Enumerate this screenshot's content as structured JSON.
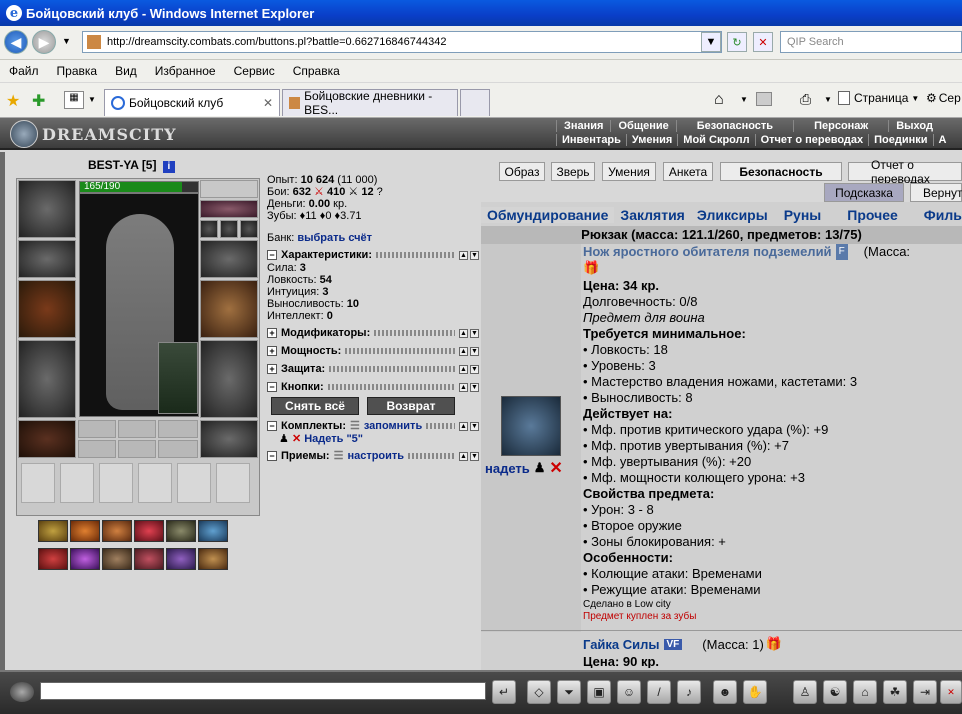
{
  "window": {
    "title": "Бойцовский клуб - Windows Internet Explorer"
  },
  "address": {
    "url": "http://dreamscity.combats.com/buttons.pl?battle=0.662716846744342",
    "search_placeholder": "QIP Search"
  },
  "menu": [
    "Файл",
    "Правка",
    "Вид",
    "Избранное",
    "Сервис",
    "Справка"
  ],
  "tabs": [
    {
      "label": "Бойцовский клуб"
    },
    {
      "label": "Бойцовские дневники - BES..."
    }
  ],
  "commands": {
    "page": "Страница",
    "service": "Сер"
  },
  "game": {
    "logo": "DREAMSCITY",
    "nav_top": [
      "Знания",
      "Общение",
      "Безопасность",
      "Персонаж",
      "Выход"
    ],
    "nav_sub": [
      "Инвентарь",
      "Умения",
      "Мой Скролл",
      "Отчет о переводах",
      "Поединки",
      "А"
    ]
  },
  "character": {
    "name": "BEST-YA",
    "level": "[5]",
    "info_icon": "i",
    "hp": "165/190",
    "hp_fraction": 0.868
  },
  "stats": {
    "exp_label": "Опыт:",
    "exp_value": "10 624",
    "exp_next": "(11 000)",
    "battles_label": "Бои:",
    "wins": "632",
    "losses": "410",
    "draws": "12",
    "money_label": "Деньги:",
    "money_value": "0.00",
    "money_unit": "кр.",
    "teeth_label": "Зубы:",
    "teeth_1": "11",
    "teeth_2": "0",
    "teeth_3": "3.71",
    "bank_label": "Банк:",
    "bank_link": "выбрать счёт",
    "chars_header": "Характеристики:",
    "attrs": [
      {
        "label": "Сила:",
        "value": "3"
      },
      {
        "label": "Ловкость:",
        "value": "54"
      },
      {
        "label": "Интуиция:",
        "value": "3"
      },
      {
        "label": "Выносливость:",
        "value": "10"
      },
      {
        "label": "Интеллект:",
        "value": "0"
      }
    ],
    "modifiers": "Модификаторы:",
    "powers": "Мощность:",
    "defense": "Защита:",
    "buttons": "Кнопки:",
    "btn_undress": "Снять всё",
    "btn_return": "Возврат",
    "sets": "Комплекты:",
    "sets_link": "запомнить",
    "wear_set": "Надеть \"5\"",
    "tricks": "Приемы:",
    "tricks_link": "настроить"
  },
  "top_buttons": [
    "Образ",
    "Зверь",
    "Умения",
    "Анкета",
    "Безопасность",
    "Отчет о переводах"
  ],
  "hint_buttons": {
    "hint": "Подсказка",
    "back": "Вернуть"
  },
  "inventory": {
    "tabs": [
      "Обмундирование",
      "Заклятия",
      "Эликсиры",
      "Руны",
      "Прочее",
      "Филь"
    ],
    "backpack": "Рюкзак (масса: 121.1/260, предметов: 13/75)",
    "wear_link": "надеть",
    "item": {
      "name": "Нож яростного обитателя подземелий",
      "badge": "F",
      "mass": "(Масса:",
      "price": "Цена: 34 кр.",
      "durability": "Долговечность: 0/8",
      "class_note": "Предмет для воина",
      "req_header": "Требуется минимальное:",
      "reqs": [
        "• Ловкость: 18",
        "• Уровень: 3",
        "• Мастерство владения ножами, кастетами: 3",
        "• Выносливость: 8"
      ],
      "acts_header": "Действует на:",
      "acts": [
        "• Мф. против критического удара (%): +9",
        "• Мф. против увертывания (%): +7",
        "• Мф. увертывания (%): +20",
        "• Мф. мощности колющего урона: +3"
      ],
      "props_header": "Свойства предмета:",
      "props": [
        "• Урон: 3 - 8",
        "• Второе оружие",
        "• Зоны блокирования: +"
      ],
      "features_header": "Особенности:",
      "features": [
        "• Колющие атаки: Временами",
        "• Режущие атаки: Временами"
      ],
      "made_in": "Сделано в Low city",
      "bought_for": "Предмет куплен за зубы"
    },
    "item2": {
      "name": "Гайка Силы",
      "badge": "VF",
      "mass": "(Масса: 1)",
      "price": "Цена: 90 кр."
    }
  },
  "colors": {
    "accent_blue": "#0a3a8a",
    "hp_green": "#1a8a1a",
    "red_note": "#c00000"
  }
}
